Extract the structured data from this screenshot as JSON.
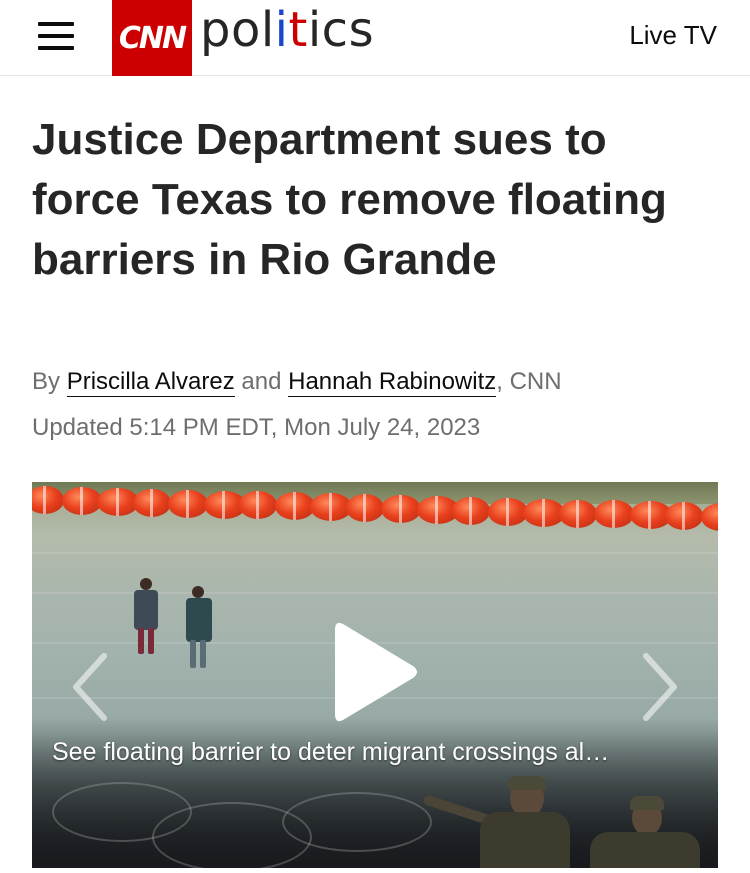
{
  "header": {
    "logo_text": "CNN",
    "section": "politics",
    "live_tv_label": "Live TV",
    "brand_color": "#cc0000"
  },
  "article": {
    "headline": "Justice Department sues to force Texas to remove floating barriers in Rio Grande",
    "byline": {
      "prefix": "By",
      "author1": "Priscilla Alvarez",
      "conjunction": "and",
      "author2": "Hannah Rabinowitz",
      "suffix": ", CNN"
    },
    "updated": "Updated 5:14 PM EDT, Mon July 24, 2023"
  },
  "video": {
    "caption": "See floating barrier to deter migrant crossings al…",
    "icons": {
      "play": "play-icon",
      "previous": "chevron-left-icon",
      "next": "chevron-right-icon"
    }
  }
}
